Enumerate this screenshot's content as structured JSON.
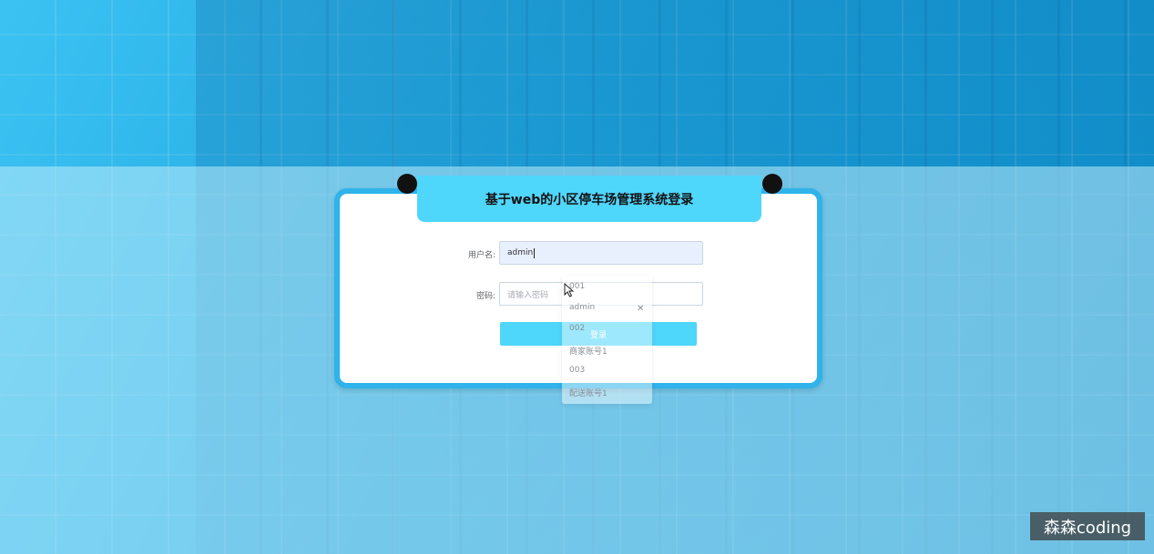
{
  "page": {
    "title": "基于web的小区停车场管理系统登录"
  },
  "form": {
    "username_label": "用户名:",
    "username_value": "admin",
    "password_label": "密码:",
    "password_placeholder": "请输入密码",
    "login_button": "登录"
  },
  "autocomplete": {
    "items": [
      "001",
      "admin",
      "002",
      "商家账号1",
      "003",
      "配送账号1"
    ]
  },
  "watermark": {
    "text": "森森coding"
  },
  "colors": {
    "accent": "#4fd6fb",
    "card_border": "#2fb3ea"
  }
}
